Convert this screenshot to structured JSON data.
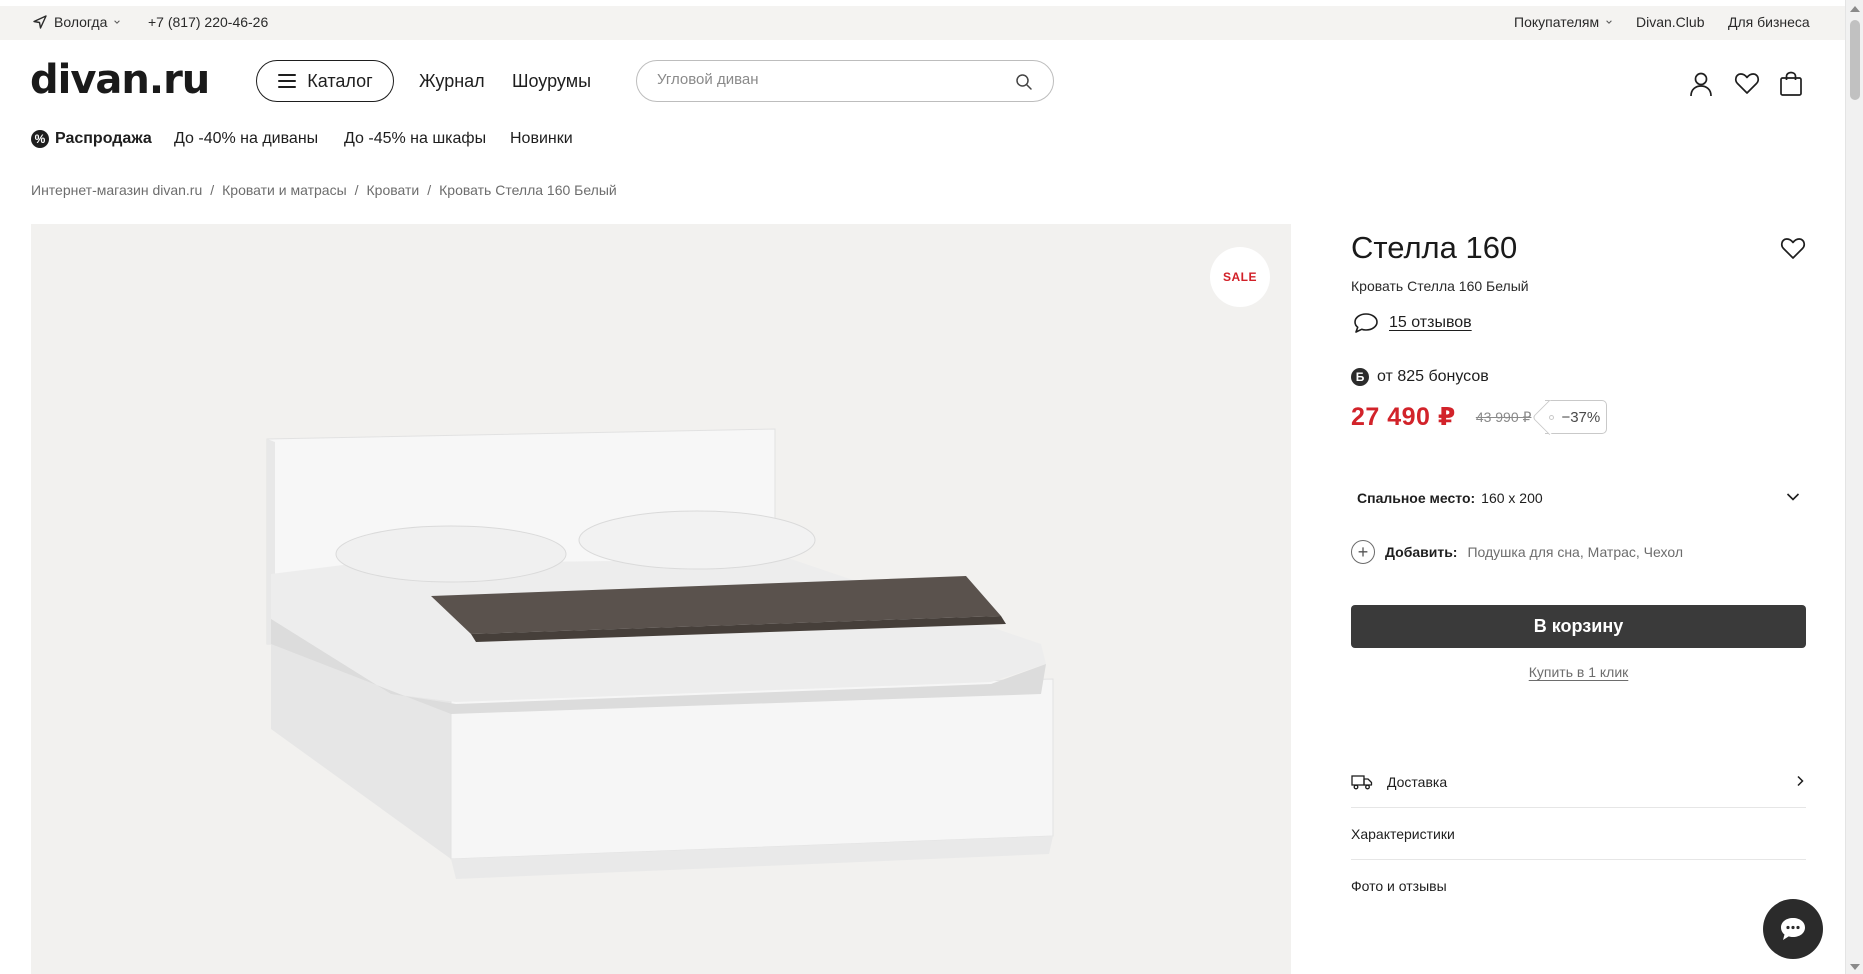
{
  "topbar": {
    "city": "Вологда",
    "phone": "+7 (817) 220-46-26",
    "buyers": "Покупателям",
    "club": "Divan.Club",
    "business": "Для бизнеса"
  },
  "header": {
    "logo": "divan.ru",
    "catalog": "Каталог",
    "journal": "Журнал",
    "showrooms": "Шоурумы",
    "search_placeholder": "Угловой диван"
  },
  "subnav": {
    "sale": "Распродажа",
    "sofas": "До -40% на диваны",
    "wardrobes": "До -45% на шкафы",
    "new": "Новинки"
  },
  "breadcrumb": [
    "Интернет-магазин divan.ru",
    "Кровати и матрасы",
    "Кровати",
    "Кровать Стелла 160 Белый"
  ],
  "gallery": {
    "sale_badge": "SALE"
  },
  "product": {
    "title": "Стелла 160",
    "subtitle": "Кровать Стелла 160 Белый",
    "reviews": "15 отзывов",
    "bonus_symbol": "Б",
    "bonus": "от 825 бонусов",
    "price": "27 490 ₽",
    "old_price": "43 990 ₽",
    "discount": "−37%",
    "size_label": "Спальное место:",
    "size_value": "160 x 200",
    "add_label": "Добавить:",
    "add_options": "Подушка для сна, Матрас, Чехол",
    "cart_button": "В корзину",
    "one_click": "Купить в 1 клик"
  },
  "accordion": {
    "delivery": "Доставка",
    "specs": "Характеристики",
    "photos": "Фото и отзывы"
  },
  "colors": {
    "accent_red": "#d2232a",
    "button_dark": "#3a3a3a",
    "gallery_bg": "#f2f1ef",
    "topbar_bg": "#f4f3f1"
  },
  "icons": [
    "location-arrow-icon",
    "search-icon",
    "user-icon",
    "heart-icon",
    "bag-icon",
    "menu-icon",
    "percent-icon",
    "chat-bubble-icon",
    "chevron-down-icon",
    "plus-icon",
    "truck-icon",
    "chevron-right-icon",
    "chat-icon"
  ]
}
